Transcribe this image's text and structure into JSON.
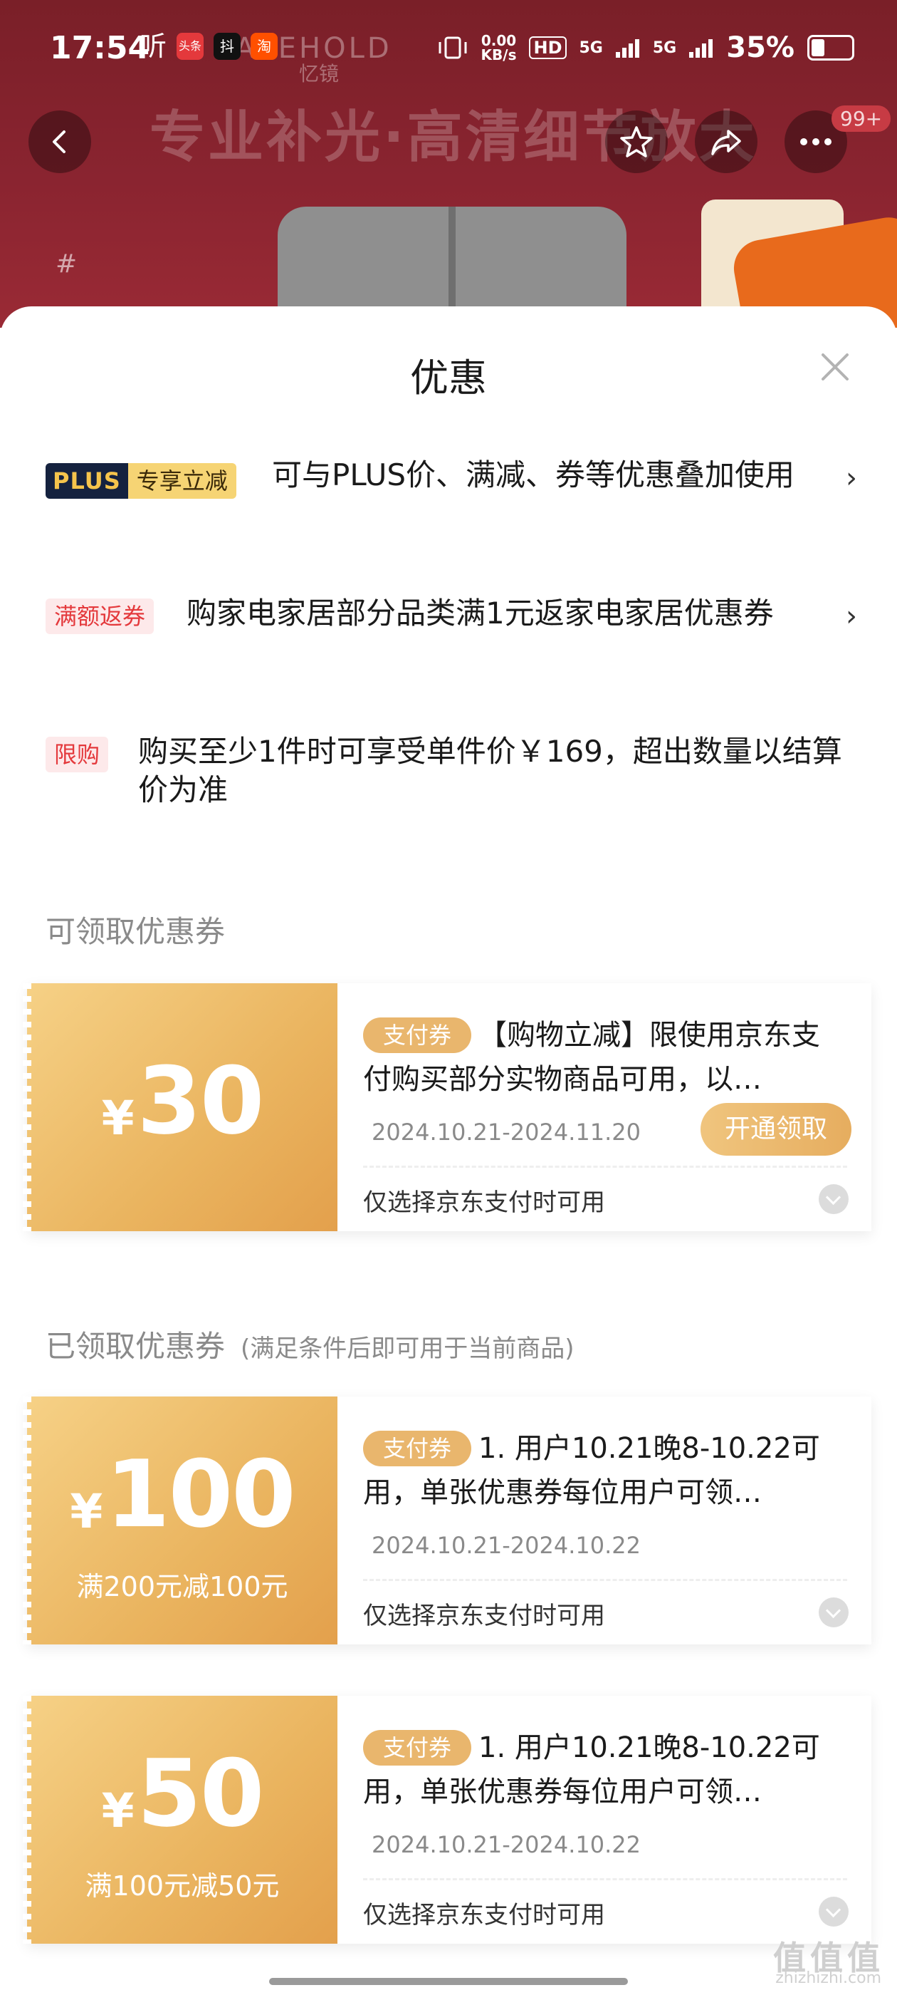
{
  "status_bar": {
    "time": "17:54",
    "app_badges": [
      "听",
      "头条",
      "抖",
      "淘"
    ],
    "net_speed_top": "0.00",
    "net_speed_bottom": "KB/s",
    "hd": "HD",
    "sim1": "5G",
    "sim2": "5G",
    "battery": "35%"
  },
  "background": {
    "brand": "ASEHOLD",
    "brand_sub": "忆镜",
    "banner_title": "专业补光·高清细节放大",
    "side_hash": "#",
    "cart_badge": "99+"
  },
  "sheet": {
    "title": "优惠"
  },
  "offers": [
    {
      "tag_left": "PLUS",
      "tag_right": "专享立减",
      "text": "可与PLUS价、满减、券等优惠叠加使用"
    },
    {
      "tag": "满额返券",
      "text": "购家电家居部分品类满1元返家电家居优惠券"
    },
    {
      "tag": "限购",
      "text": "购买至少1件时可享受单件价￥169，超出数量以结算价为准"
    }
  ],
  "available_section": {
    "label": "可领取优惠券"
  },
  "claimed_section": {
    "label": "已领取优惠券",
    "hint": "(满足条件后即可用于当前商品)"
  },
  "coupons": [
    {
      "yen": "¥",
      "amount": "30",
      "condition": "",
      "tag": "支付券",
      "desc": "【购物立减】限使用京东支付购买部分实物商品可用，以…",
      "date": "2024.10.21-2024.11.20",
      "button": "开通领取",
      "note": "仅选择京东支付时可用"
    },
    {
      "yen": "¥",
      "amount": "100",
      "condition": "满200元减100元",
      "tag": "支付券",
      "desc": "1. 用户10.21晚8-10.22可用，单张优惠券每位用户可领…",
      "date": "2024.10.21-2024.10.22",
      "note": "仅选择京东支付时可用"
    },
    {
      "yen": "¥",
      "amount": "50",
      "condition": "满100元减50元",
      "tag": "支付券",
      "desc": "1. 用户10.21晚8-10.22可用，单张优惠券每位用户可领…",
      "date": "2024.10.21-2024.10.22",
      "note": "仅选择京东支付时可用"
    }
  ],
  "watermark": {
    "text": "值值值",
    "sub": "zhizhizhi.com"
  },
  "colors": {
    "accent_red": "#e4393c",
    "coupon_gold": "#eab45f",
    "plus_navy": "#15223f"
  }
}
